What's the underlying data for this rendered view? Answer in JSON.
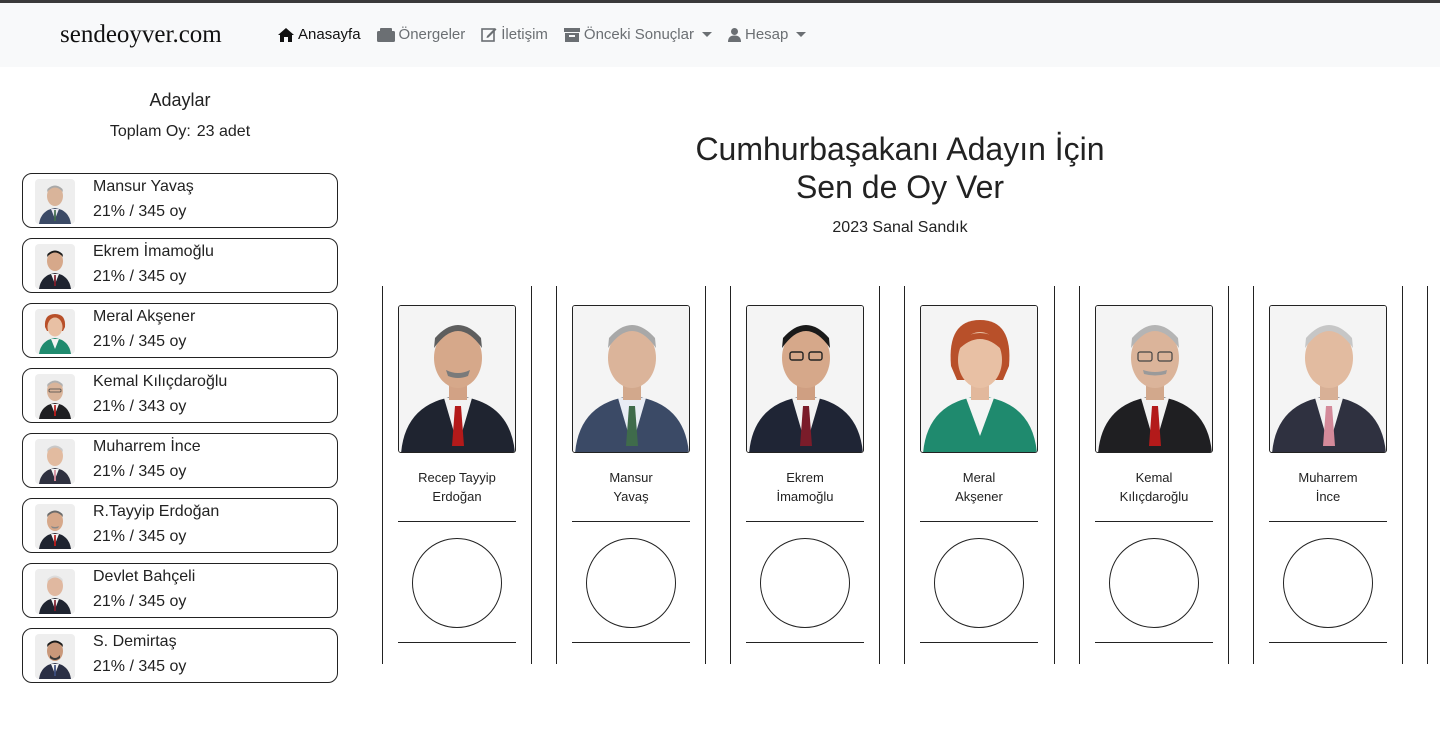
{
  "brand": "sendeoyver.com",
  "nav": [
    {
      "label": "Anasayfa",
      "icon": "home-icon",
      "active": true
    },
    {
      "label": "Önergeler",
      "icon": "box-icon"
    },
    {
      "label": "İletişim",
      "icon": "edit-icon"
    },
    {
      "label": "Önceki Sonuçlar",
      "icon": "archive-icon",
      "dropdown": true
    },
    {
      "label": "Hesap",
      "icon": "user-icon",
      "dropdown": true
    }
  ],
  "sidebar": {
    "title": "Adaylar",
    "total_label": "Toplam Oy:",
    "total_value": "23 adet",
    "candidates": [
      {
        "name": "Mansur Yavaş",
        "stats": "21% / 345 oy"
      },
      {
        "name": "Ekrem İmamoğlu",
        "stats": "21% / 345 oy"
      },
      {
        "name": "Meral Akşener",
        "stats": "21% / 345 oy"
      },
      {
        "name": "Kemal Kılıçdaroğlu",
        "stats": "21% / 343 oy"
      },
      {
        "name": "Muharrem İnce",
        "stats": "21% / 345 oy"
      },
      {
        "name": "R.Tayyip Erdoğan",
        "stats": "21% / 345 oy"
      },
      {
        "name": "Devlet Bahçeli",
        "stats": "21% / 345 oy"
      },
      {
        "name": "S. Demirtaş",
        "stats": "21% / 345 oy"
      }
    ]
  },
  "hero": {
    "line1": "Cumhurbaşakanı Adayın İçin",
    "line2": "Sen de Oy Ver",
    "subtitle": "2023 Sanal Sandık"
  },
  "ballot": [
    {
      "first": "Recep Tayyip",
      "last": "Erdoğan"
    },
    {
      "first": "Mansur",
      "last": "Yavaş"
    },
    {
      "first": "Ekrem",
      "last": "İmamoğlu"
    },
    {
      "first": "Meral",
      "last": "Akşener"
    },
    {
      "first": "Kemal",
      "last": "Kılıçdaroğlu"
    },
    {
      "first": "Muharrem",
      "last": "İnce"
    }
  ],
  "colors": {
    "navbar_bg": "#f8f9fa",
    "nav_text": "#6b6f73",
    "text": "#212529",
    "border": "#222222"
  }
}
